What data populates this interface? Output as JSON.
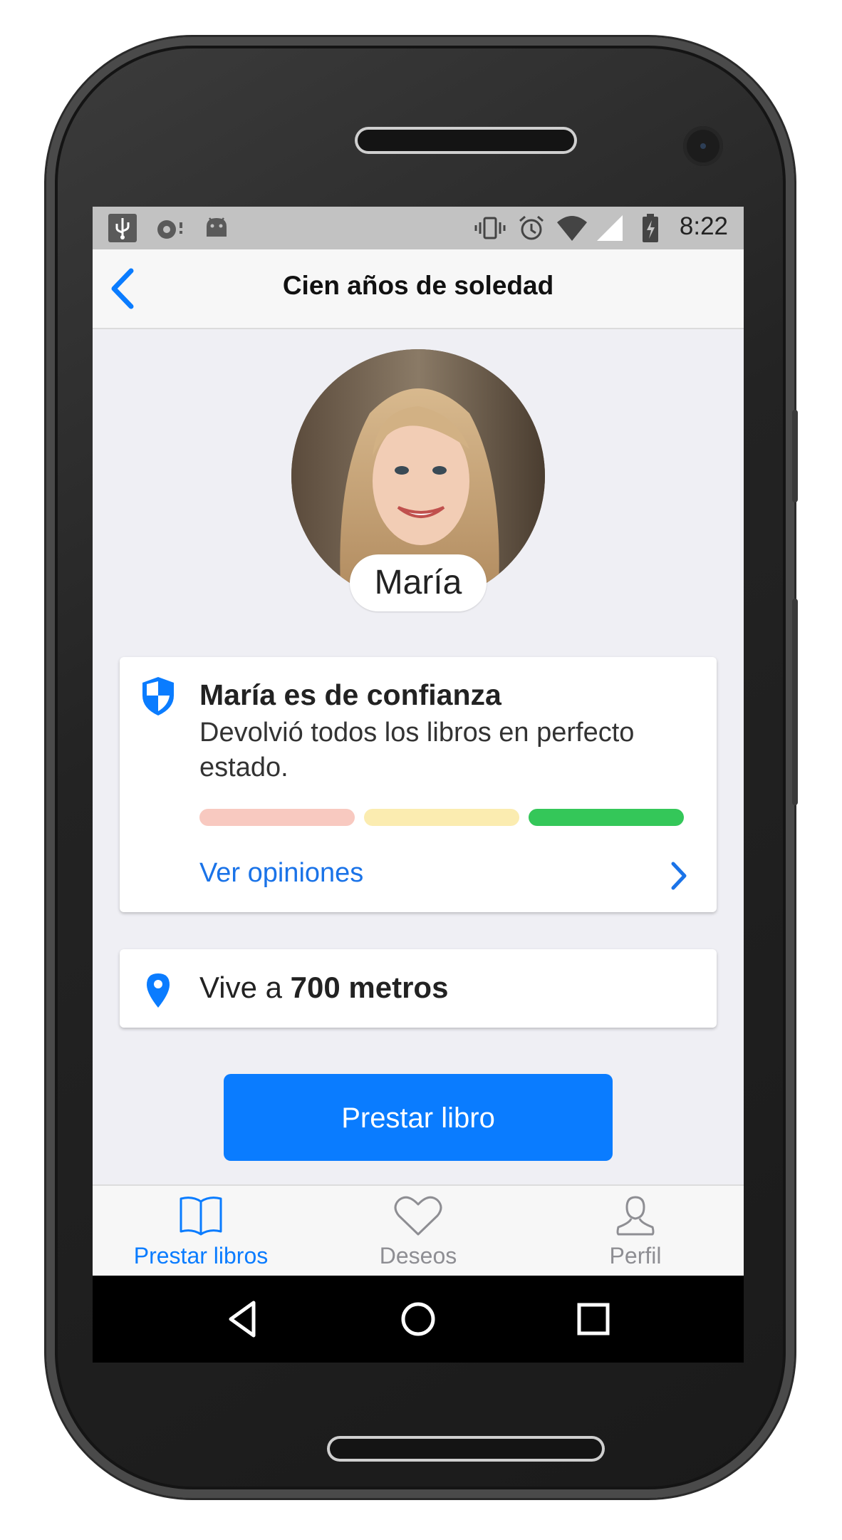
{
  "status_bar": {
    "time": "8:22",
    "left_icons": [
      "usb-icon",
      "sync-icon",
      "android-debug-icon"
    ],
    "right_icons": [
      "vibrate-icon",
      "alarm-icon",
      "wifi-icon",
      "signal-icon",
      "battery-charging-icon"
    ]
  },
  "header": {
    "title": "Cien años de soledad",
    "back_icon": "chevron-left-icon"
  },
  "profile": {
    "name": "María"
  },
  "trust": {
    "icon": "shield-icon",
    "title": "María es de confianza",
    "description": "Devolvió todos los libros en perfecto estado.",
    "level": "3 of 3 (high)",
    "levels_colors": [
      "#f8c9c0",
      "#fbecb0",
      "#34c759"
    ],
    "link_label": "Ver opiniones"
  },
  "location": {
    "icon": "map-pin-icon",
    "prefix": "Vive a ",
    "distance": "700 metros"
  },
  "primary_action": {
    "label": "Prestar libro"
  },
  "tab_bar": {
    "tabs": [
      {
        "label": "Prestar libros",
        "icon": "book-icon",
        "active": true
      },
      {
        "label": "Deseos",
        "icon": "heart-icon",
        "active": false
      },
      {
        "label": "Perfil",
        "icon": "user-icon",
        "active": false
      }
    ]
  },
  "system_nav": [
    "back-triangle-icon",
    "home-circle-icon",
    "recents-square-icon"
  ],
  "colors": {
    "accent": "#0a7cff",
    "link": "#1a73e8",
    "background": "#efeff4",
    "inactive_tab": "#8e8e93"
  }
}
